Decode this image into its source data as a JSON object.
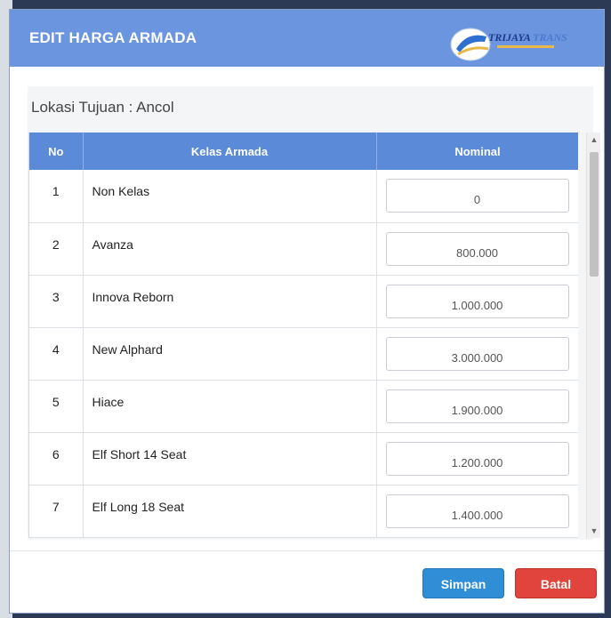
{
  "modal": {
    "title": "EDIT HARGA ARMADA",
    "logo": {
      "name": "TRIJAYA",
      "name_accent": "TRANS"
    }
  },
  "lokasi": "Lokasi Tujuan : Ancol",
  "table": {
    "headers": [
      "No",
      "Kelas Armada",
      "Nominal"
    ],
    "rows": [
      {
        "no": "1",
        "kelas": "Non Kelas",
        "nominal": "0"
      },
      {
        "no": "2",
        "kelas": "Avanza",
        "nominal": "800.000"
      },
      {
        "no": "3",
        "kelas": "Innova Reborn",
        "nominal": "1.000.000"
      },
      {
        "no": "4",
        "kelas": "New Alphard",
        "nominal": "3.000.000"
      },
      {
        "no": "5",
        "kelas": "Hiace",
        "nominal": "1.900.000"
      },
      {
        "no": "6",
        "kelas": "Elf Short 14 Seat",
        "nominal": "1.200.000"
      },
      {
        "no": "7",
        "kelas": "Elf Long 18 Seat",
        "nominal": "1.400.000"
      }
    ]
  },
  "buttons": {
    "save": "Simpan",
    "cancel": "Batal"
  },
  "colors": {
    "header": "#6b95df",
    "table_header": "#5b8ad9",
    "save": "#2f8ed6",
    "cancel": "#e0443c"
  },
  "icons": {
    "scroll_up": "triangle-up",
    "scroll_down": "triangle-down",
    "logo": "bus-logo-icon"
  }
}
